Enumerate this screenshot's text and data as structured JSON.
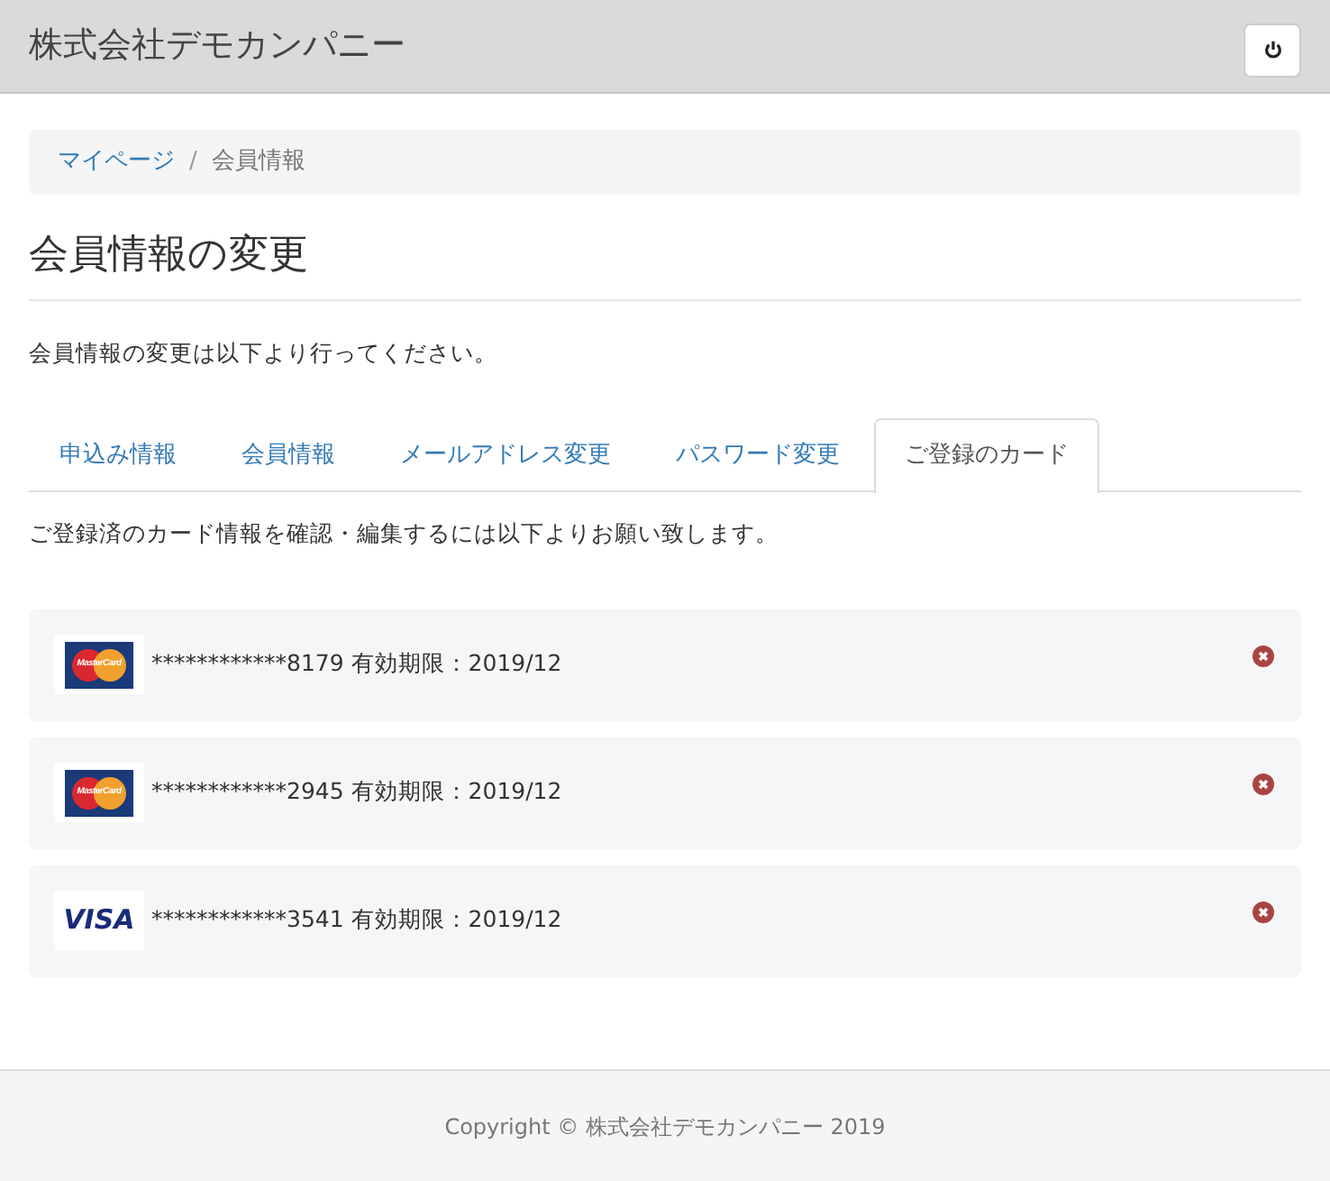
{
  "header": {
    "title": "株式会社デモカンパニー"
  },
  "breadcrumb_separator": "/",
  "breadcrumb": [
    {
      "label": "マイページ",
      "link": true
    },
    {
      "label": "会員情報",
      "link": false
    }
  ],
  "heading": "会員情報の変更",
  "intro": "会員情報の変更は以下より行ってください。",
  "tabs": [
    {
      "label": "申込み情報",
      "selected": false
    },
    {
      "label": "会員情報",
      "selected": false
    },
    {
      "label": "メールアドレス変更",
      "selected": false
    },
    {
      "label": "パスワード変更",
      "selected": false
    },
    {
      "label": "ご登録のカード",
      "selected": true
    }
  ],
  "tab_text": "ご登録済のカード情報を確認・編集するには以下よりお願い致します。",
  "cards": [
    {
      "kind": "mastercard",
      "logo_text": "MasterCard",
      "text": "************8179 有効期限：2019/12"
    },
    {
      "kind": "mastercard",
      "logo_text": "MasterCard",
      "text": "************2945 有効期限：2019/12"
    },
    {
      "kind": "visa",
      "logo_text": "VISA",
      "text": "************3541 有効期限：2019/12"
    }
  ],
  "footer": "Copyright © 株式会社デモカンパニー 2019"
}
